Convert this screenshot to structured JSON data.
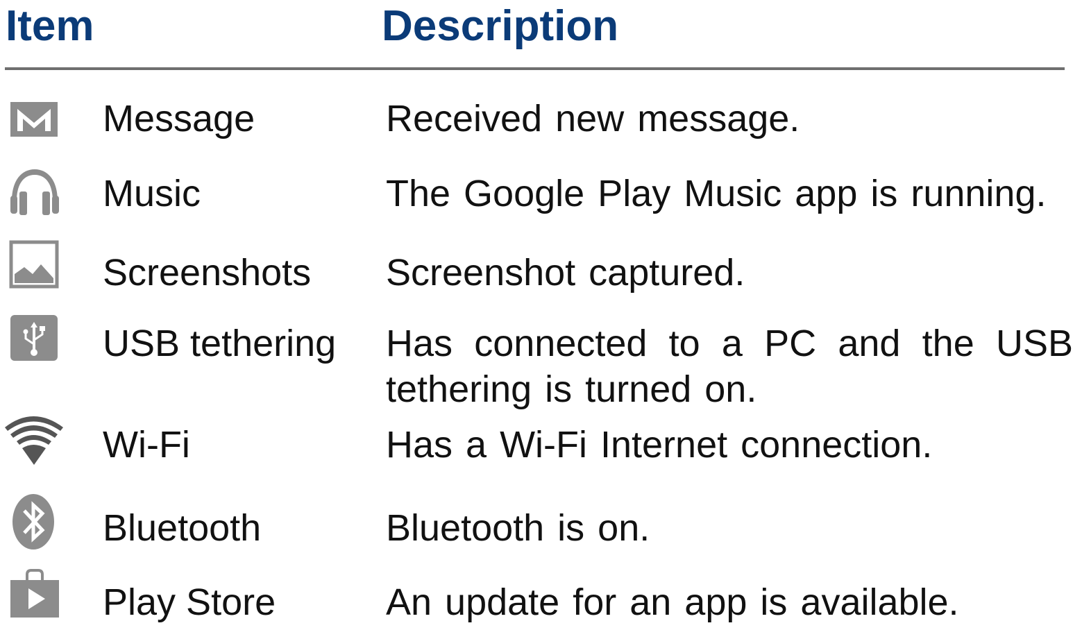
{
  "header": {
    "item_label": "Item",
    "description_label": "Description"
  },
  "colors": {
    "heading": "#0b3b78",
    "icon": "#8c8c8c",
    "rule": "#6f6f6f"
  },
  "rows": [
    {
      "icon": "envelope-icon",
      "item": "Message",
      "description": "Received new message."
    },
    {
      "icon": "headphones-icon",
      "item": "Music",
      "description": "The Google Play Music app is running."
    },
    {
      "icon": "picture-icon",
      "item": "Screenshots",
      "description": "Screenshot captured."
    },
    {
      "icon": "usb-icon",
      "item": "USB tethering",
      "description": "Has connected to a PC and the USB tethering is turned on."
    },
    {
      "icon": "wifi-icon",
      "item": "Wi-Fi",
      "description": "Has a Wi-Fi Internet connection."
    },
    {
      "icon": "bluetooth-icon",
      "item": "Bluetooth",
      "description": "Bluetooth is on."
    },
    {
      "icon": "play-store-icon",
      "item": "Play Store",
      "description": "An update for an app is available."
    }
  ]
}
